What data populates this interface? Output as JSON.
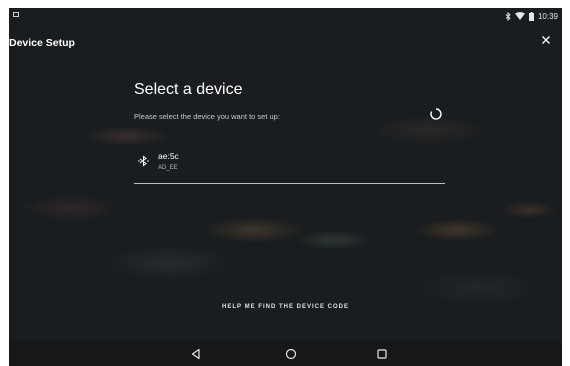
{
  "status_bar": {
    "time": "10:39",
    "icons": [
      "notification-icon",
      "bluetooth-icon",
      "wifi-icon",
      "battery-icon"
    ]
  },
  "app_bar": {
    "title": "Device Setup",
    "close_icon": "close-icon"
  },
  "main": {
    "heading": "Select a device",
    "subheading": "Please select the device you want to set up:",
    "loading": true,
    "devices": [
      {
        "name": "ae:5c",
        "detail": "AD_EE",
        "icon": "bluetooth-icon"
      }
    ]
  },
  "footer": {
    "help_link": "HELP ME FIND THE DEVICE CODE"
  },
  "nav_bar": {
    "buttons": [
      "back-icon",
      "home-icon",
      "recents-icon"
    ]
  }
}
